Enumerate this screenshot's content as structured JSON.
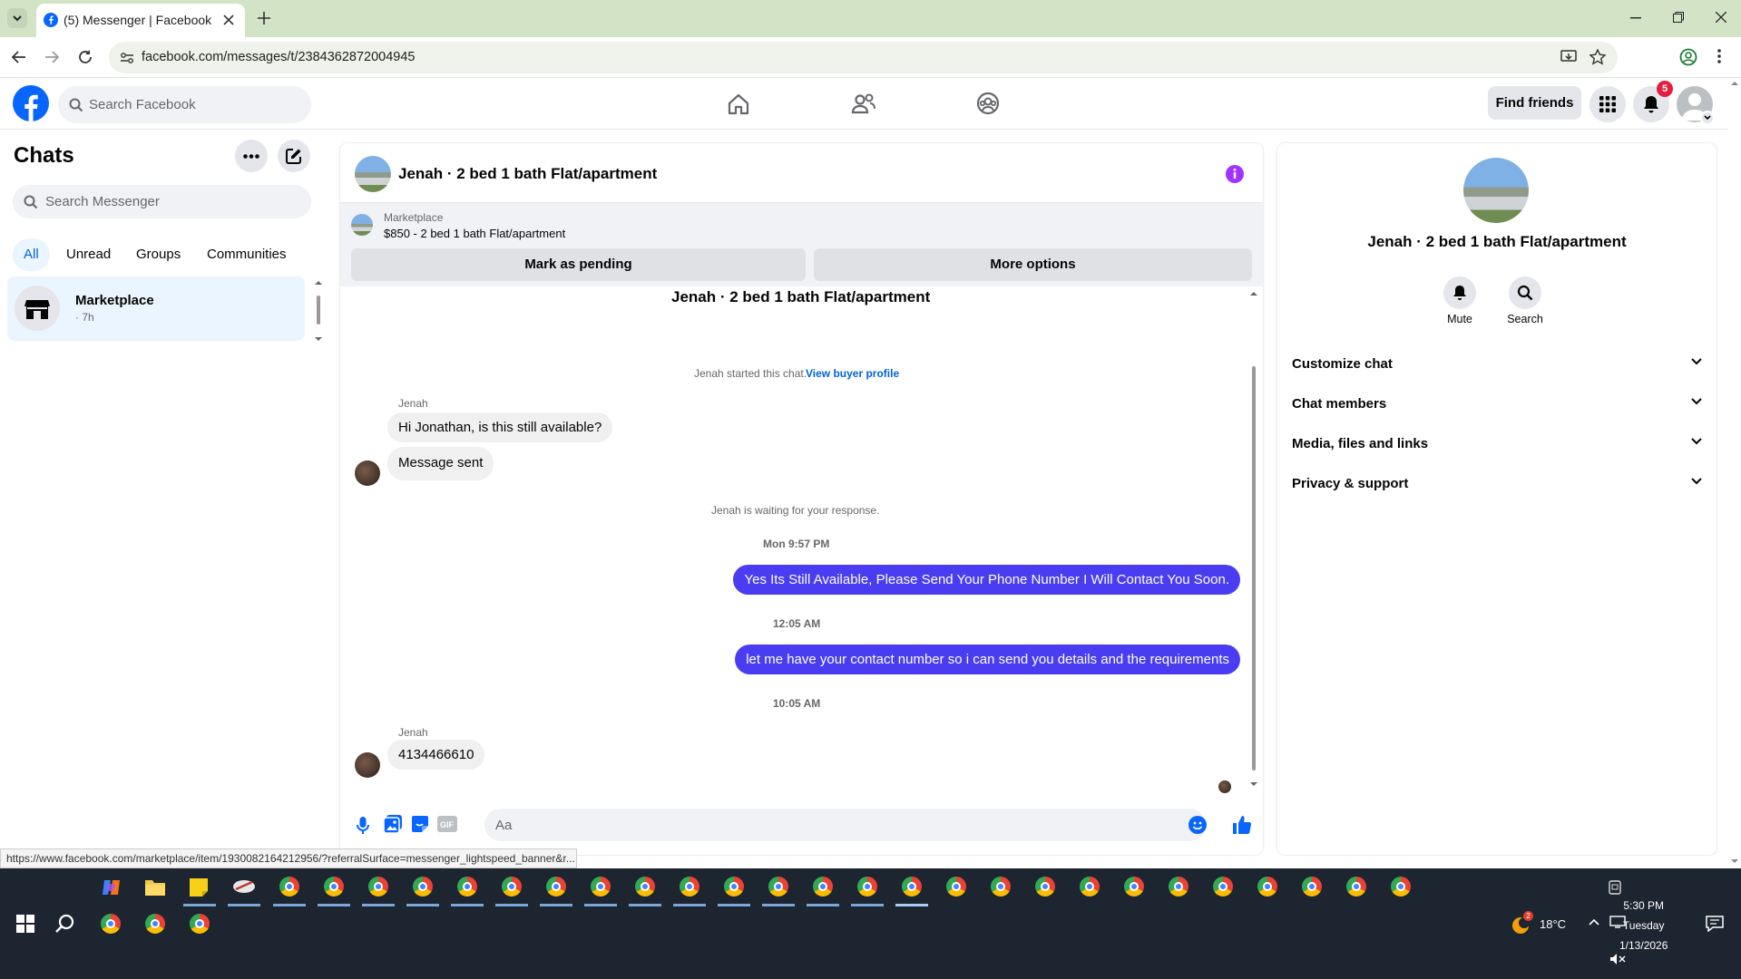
{
  "browser": {
    "tab_title": "(5) Messenger | Facebook",
    "url": "facebook.com/messages/t/2384362872004945",
    "status_url": "https://www.facebook.com/marketplace/item/1930082164212956/?referralSurface=messenger_lightspeed_banner&r..."
  },
  "fb_header": {
    "search_placeholder": "Search Facebook",
    "find_friends_label": "Find friends",
    "notification_count": "5"
  },
  "chats": {
    "title": "Chats",
    "search_placeholder": "Search Messenger",
    "filters": [
      "All",
      "Unread",
      "Groups",
      "Communities"
    ],
    "active_filter": "All",
    "items": [
      {
        "name": "Marketplace",
        "time": "· 7h"
      }
    ]
  },
  "conversation": {
    "title": "Jenah · 2 bed 1 bath Flat/apartment",
    "banner": {
      "source": "Marketplace",
      "listing": "$850 - 2 bed 1 bath Flat/apartment",
      "mark_pending_label": "Mark as pending",
      "more_options_label": "More options"
    },
    "thread_title": "Jenah · 2 bed 1 bath Flat/apartment",
    "started_text": "Jenah started this chat.",
    "view_profile_link": "View buyer profile",
    "sender_1": "Jenah",
    "msg_in_1": "Hi Jonathan, is this still available?",
    "msg_in_2": "Message sent",
    "waiting_text": "Jenah is waiting for your response.",
    "time_1": "Mon 9:57 PM",
    "msg_out_1": "Yes Its Still Available, Please Send Your Phone Number I Will Contact You Soon.",
    "time_2": "12:05 AM",
    "msg_out_2": "let me have your contact number so i can send you details and the requirements",
    "time_3": "10:05 AM",
    "sender_2": "Jenah",
    "msg_in_3": "4134466610",
    "composer_placeholder": "Aa"
  },
  "details": {
    "title": "Jenah · 2 bed 1 bath Flat/apartment",
    "mute_label": "Mute",
    "search_label": "Search",
    "sections": [
      "Customize chat",
      "Chat members",
      "Media, files and links",
      "Privacy & support"
    ]
  },
  "taskbar": {
    "weather": "18°C",
    "time": "5:30 PM",
    "day": "Tuesday",
    "date": "1/13/2026",
    "weather_badge": "2"
  },
  "colors": {
    "fb_blue": "#0866ff",
    "bubble_out": "#4a3cf0",
    "info_icon": "#a033ff",
    "browser_tabstrip": "#d3e3c5"
  }
}
